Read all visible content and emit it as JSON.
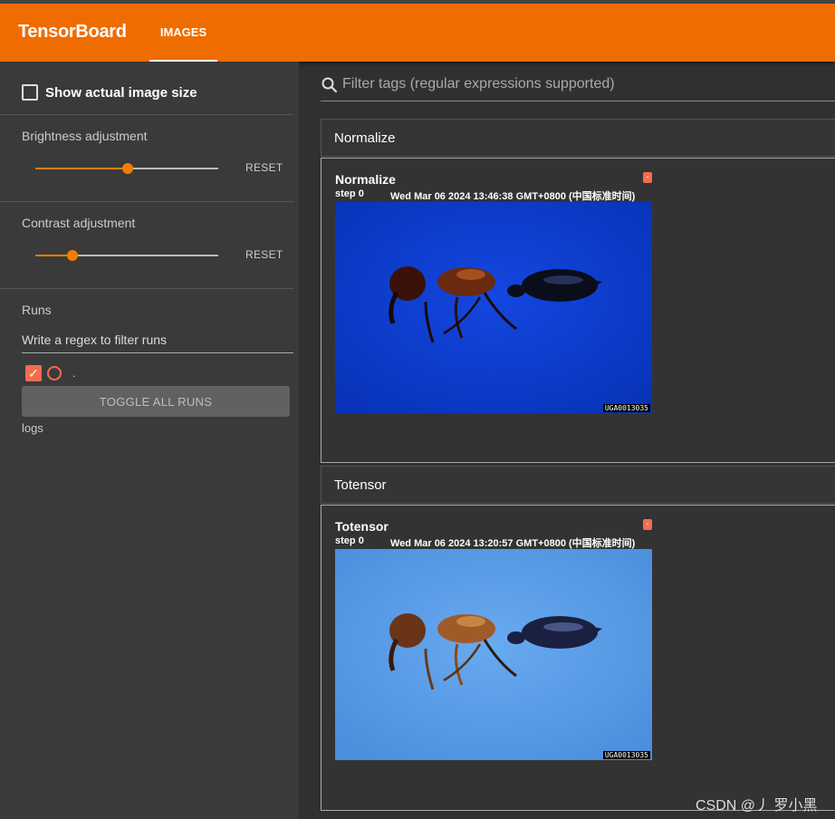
{
  "app": {
    "brand": "TensorBoard",
    "active_tab": "IMAGES"
  },
  "sidebar": {
    "show_actual_size_label": "Show actual image size",
    "show_actual_size_checked": false,
    "brightness": {
      "label": "Brightness adjustment",
      "value": 0.5,
      "reset_label": "RESET"
    },
    "contrast": {
      "label": "Contrast adjustment",
      "value": 0.2,
      "reset_label": "RESET"
    },
    "runs": {
      "title": "Runs",
      "filter_placeholder": "Write a regex to filter runs",
      "items": [
        {
          "name": ".",
          "checked": true
        }
      ],
      "toggle_all_label": "TOGGLE ALL RUNS",
      "logdir": "logs"
    }
  },
  "main": {
    "filter_placeholder": "Filter tags (regular expressions supported)",
    "groups": [
      {
        "header": "Normalize",
        "card": {
          "title": "Normalize",
          "step_label": "step",
          "step_value": "0",
          "timestamp": "Wed Mar 06 2024 13:46:38 GMT+0800 (中国标准时间)",
          "image_label": "UGA0013035",
          "bg_color": "#0b3fd6"
        }
      },
      {
        "header": "Totensor",
        "card": {
          "title": "Totensor",
          "step_label": "step",
          "step_value": "0",
          "timestamp": "Wed Mar 06 2024 13:20:57 GMT+0800 (中国标准时间)",
          "image_label": "UGA0013035",
          "bg_color": "#5a9ee8"
        }
      }
    ]
  },
  "watermark": "CSDN @丿 罗小黑",
  "colors": {
    "accent": "#ef6c00",
    "run_color": "#f36c4f"
  }
}
